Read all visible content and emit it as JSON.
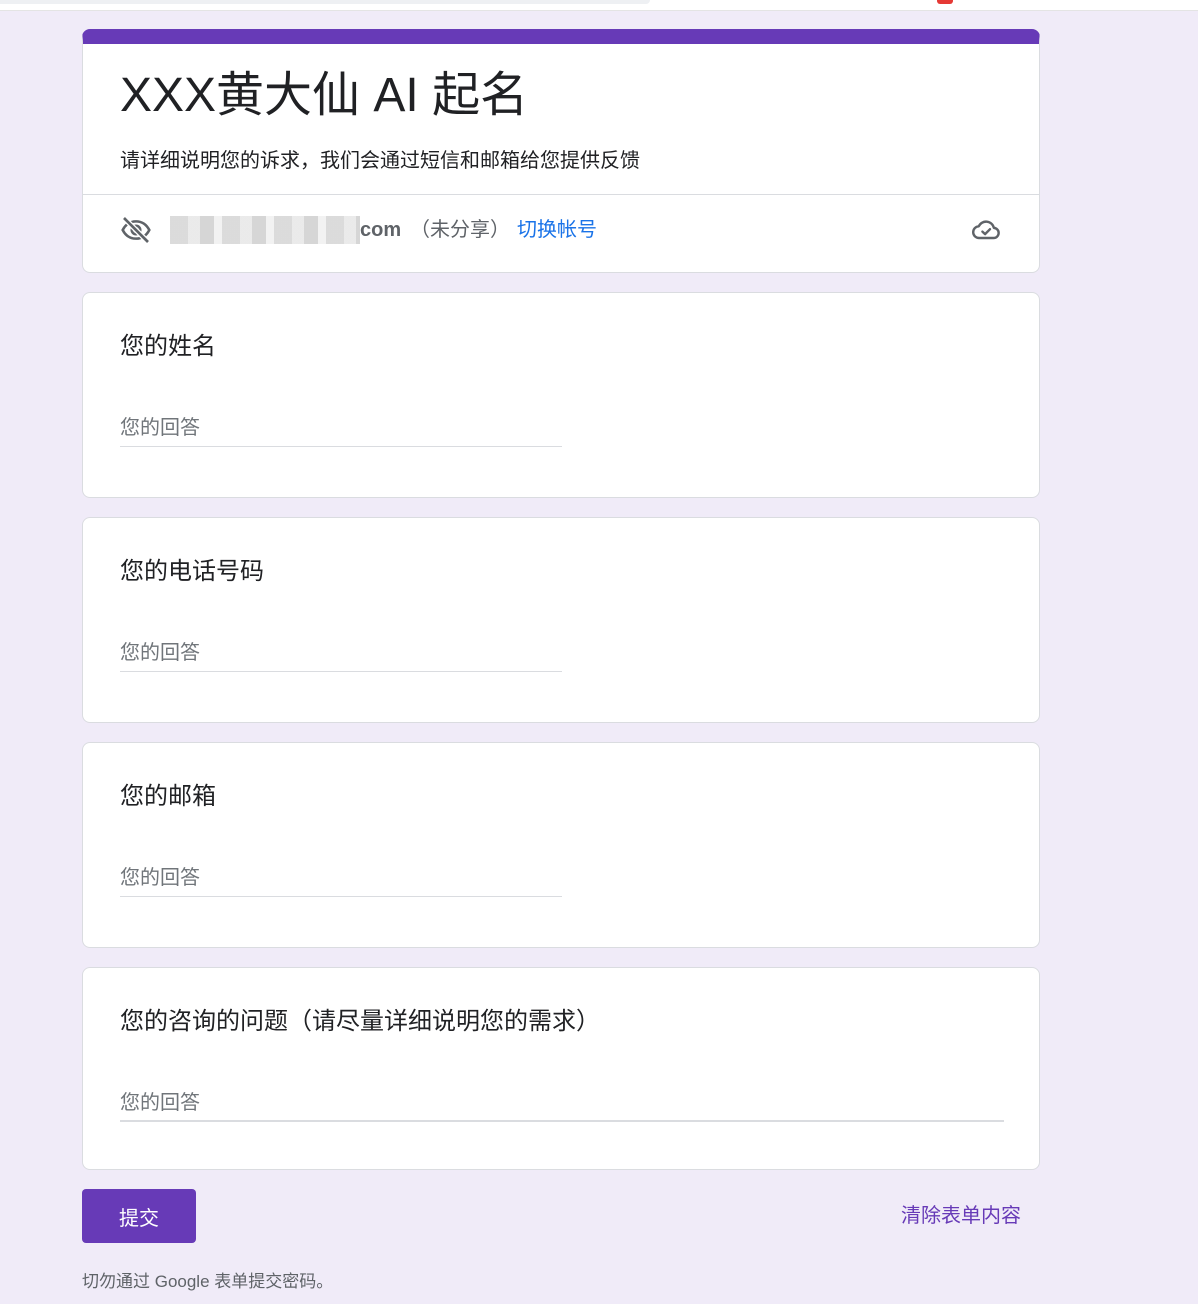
{
  "form": {
    "title": "XXX黄大仙 AI 起名",
    "description": "请详细说明您的诉求，我们会通过短信和邮箱给您提供反馈",
    "accent_color": "#673ab7",
    "background_color": "#f0ebf8"
  },
  "account": {
    "email_suffix": "com",
    "share_status": "（未分享）",
    "switch_label": "切换帐号",
    "privacy_icon": "eye-off-icon",
    "save_icon": "cloud-done-icon"
  },
  "questions": [
    {
      "title": "您的姓名",
      "placeholder": "您的回答"
    },
    {
      "title": "您的电话号码",
      "placeholder": "您的回答"
    },
    {
      "title": "您的邮箱",
      "placeholder": "您的回答"
    },
    {
      "title": "您的咨询的问题（请尽量详细说明您的需求）",
      "placeholder": "您的回答"
    }
  ],
  "actions": {
    "submit_label": "提交",
    "clear_label": "清除表单内容"
  },
  "footer": {
    "note": "切勿通过 Google 表单提交密码。"
  }
}
